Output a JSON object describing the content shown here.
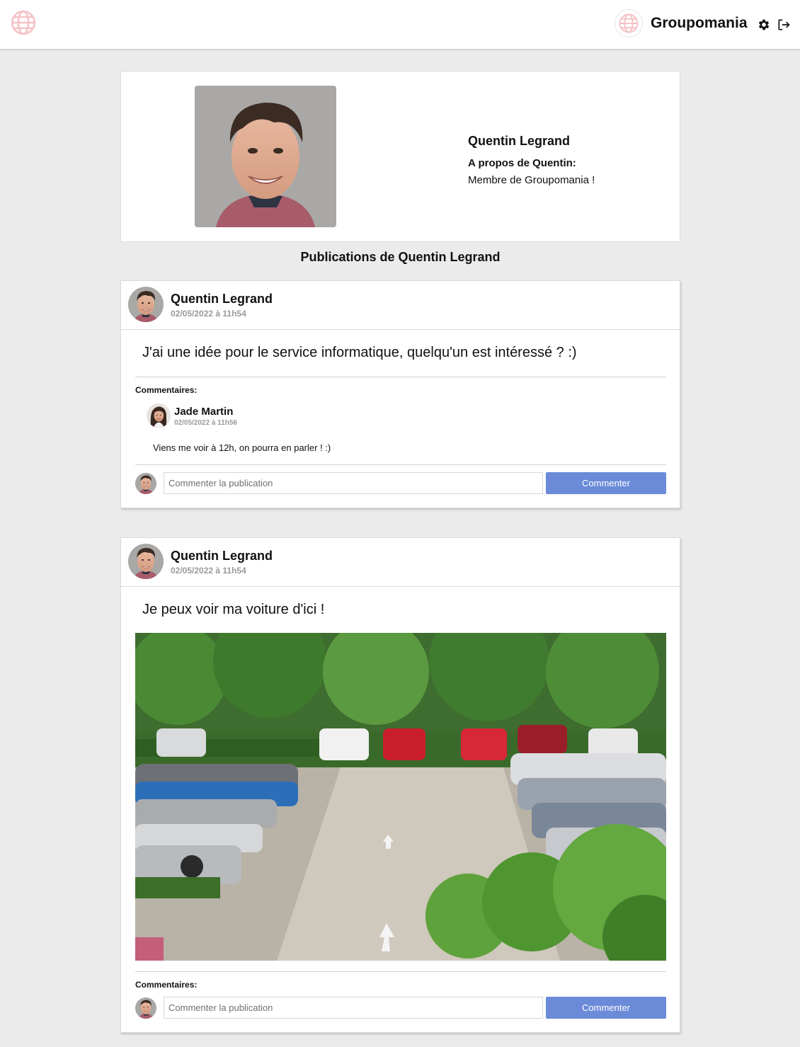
{
  "header": {
    "brand_name": "Groupomania",
    "logo_icon": "globe-icon",
    "settings_icon": "gear-icon",
    "logout_icon": "logout-icon",
    "logo_color": "#f5c2c5"
  },
  "profile": {
    "name": "Quentin Legrand",
    "about_label": "A propos de Quentin:",
    "about_text": "Membre de Groupomania !"
  },
  "section_title": "Publications de Quentin Legrand",
  "posts": [
    {
      "author": "Quentin Legrand",
      "date": "02/05/2022 à 11h54",
      "text": "J'ai une idée pour le service informatique, quelqu'un est intéressé ? :)",
      "comments_label": "Commentaires:",
      "comments": [
        {
          "author": "Jade Martin",
          "date": "02/05/2022 à 11h56",
          "text": "Viens me voir à 12h, on pourra en parler ! :)"
        }
      ],
      "comment_placeholder": "Commenter la publication",
      "comment_button": "Commenter"
    },
    {
      "author": "Quentin Legrand",
      "date": "02/05/2022 à 11h54",
      "text": "Je peux voir ma voiture d'ici !",
      "image": "parking-lot-photo",
      "comments_label": "Commentaires:",
      "comments": [],
      "comment_placeholder": "Commenter la publication",
      "comment_button": "Commenter"
    }
  ],
  "colors": {
    "accent_button": "#6b8bd8",
    "page_background": "#ebebeb"
  }
}
